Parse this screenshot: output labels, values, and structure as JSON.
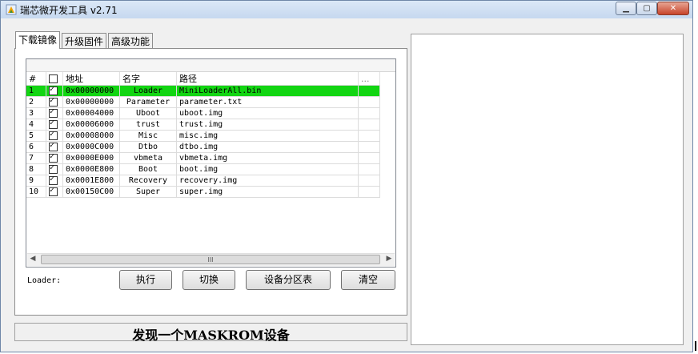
{
  "window": {
    "title": "瑞芯微开发工具 v2.71"
  },
  "tabs": [
    {
      "label": "下载镜像",
      "active": true
    },
    {
      "label": "升级固件",
      "active": false
    },
    {
      "label": "高级功能",
      "active": false
    }
  ],
  "table": {
    "columns": [
      "#",
      "",
      "地址",
      "名字",
      "路径",
      "..."
    ],
    "rows": [
      {
        "num": "1",
        "checked": true,
        "address": "0x00000000",
        "name": "Loader",
        "path": "MiniLoaderAll.bin",
        "selected": true
      },
      {
        "num": "2",
        "checked": true,
        "address": "0x00000000",
        "name": "Parameter",
        "path": "parameter.txt"
      },
      {
        "num": "3",
        "checked": true,
        "address": "0x00004000",
        "name": "Uboot",
        "path": "uboot.img"
      },
      {
        "num": "4",
        "checked": true,
        "address": "0x00006000",
        "name": "trust",
        "path": "trust.img"
      },
      {
        "num": "5",
        "checked": true,
        "address": "0x00008000",
        "name": "Misc",
        "path": "misc.img"
      },
      {
        "num": "6",
        "checked": true,
        "address": "0x0000C000",
        "name": "Dtbo",
        "path": "dtbo.img"
      },
      {
        "num": "7",
        "checked": true,
        "address": "0x0000E000",
        "name": "vbmeta",
        "path": "vbmeta.img"
      },
      {
        "num": "8",
        "checked": true,
        "address": "0x0000E800",
        "name": "Boot",
        "path": "boot.img"
      },
      {
        "num": "9",
        "checked": true,
        "address": "0x0001E800",
        "name": "Recovery",
        "path": "recovery.img"
      },
      {
        "num": "10",
        "checked": true,
        "address": "0x00150C00",
        "name": "Super",
        "path": "super.img"
      }
    ]
  },
  "scrollbar": {
    "thumb_glyph": "III"
  },
  "loader_label": "Loader:",
  "buttons": {
    "run": "执行",
    "switch": "切换",
    "partition_table": "设备分区表",
    "clear": "清空"
  },
  "status": {
    "text": "发现一个MASKROM设备"
  },
  "colors": {
    "selected_row": "#12d512",
    "title_bar": "#c6d8ef",
    "close_button": "#c7432a"
  }
}
